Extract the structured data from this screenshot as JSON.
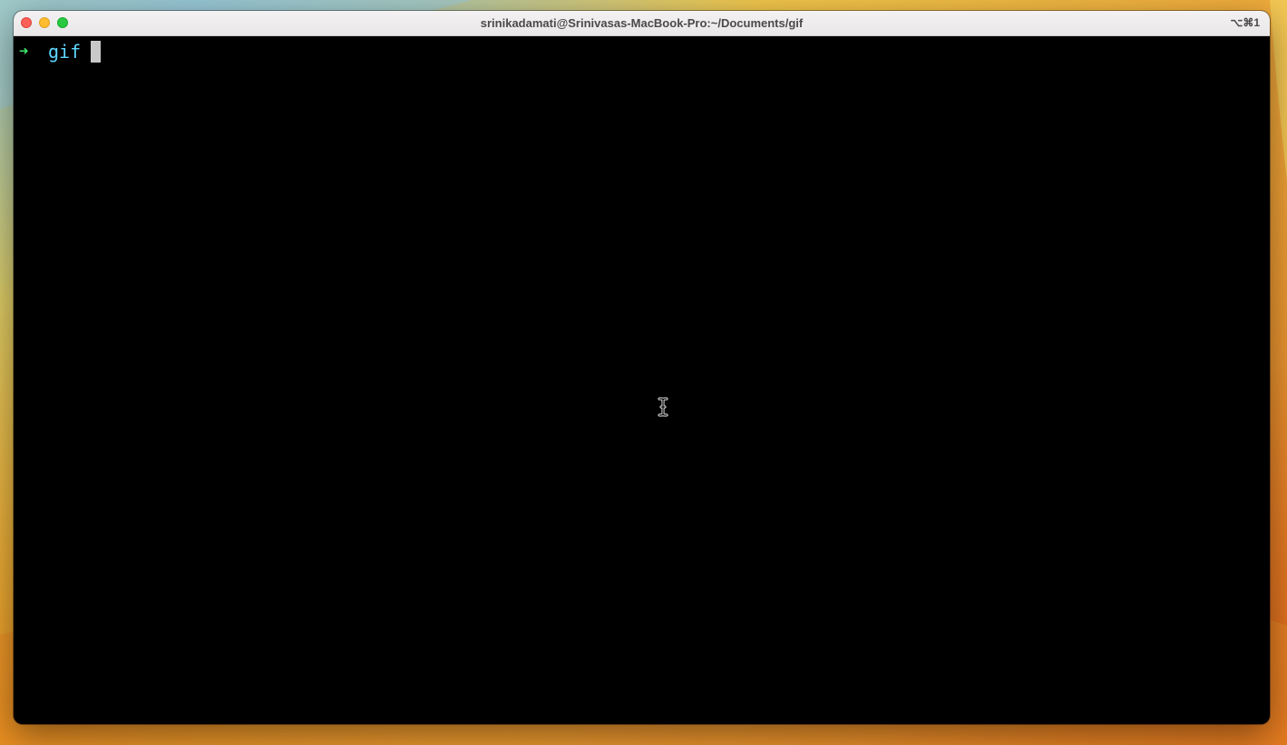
{
  "window": {
    "title": "srinikadamati@Srinivasas-MacBook-Pro:~/Documents/gif",
    "shortcut": "⌥⌘1"
  },
  "terminal": {
    "prompt_arrow": "➜",
    "current_directory": "gif",
    "input_text": ""
  },
  "colors": {
    "prompt_arrow": "#3ee86a",
    "directory": "#5fd7ff",
    "background": "#000000",
    "cursor": "#c8c8c8"
  },
  "icons": {
    "traffic_lights": [
      "close-button",
      "minimize-button",
      "zoom-button"
    ],
    "mouse_cursor": "i-beam-cursor-icon"
  }
}
